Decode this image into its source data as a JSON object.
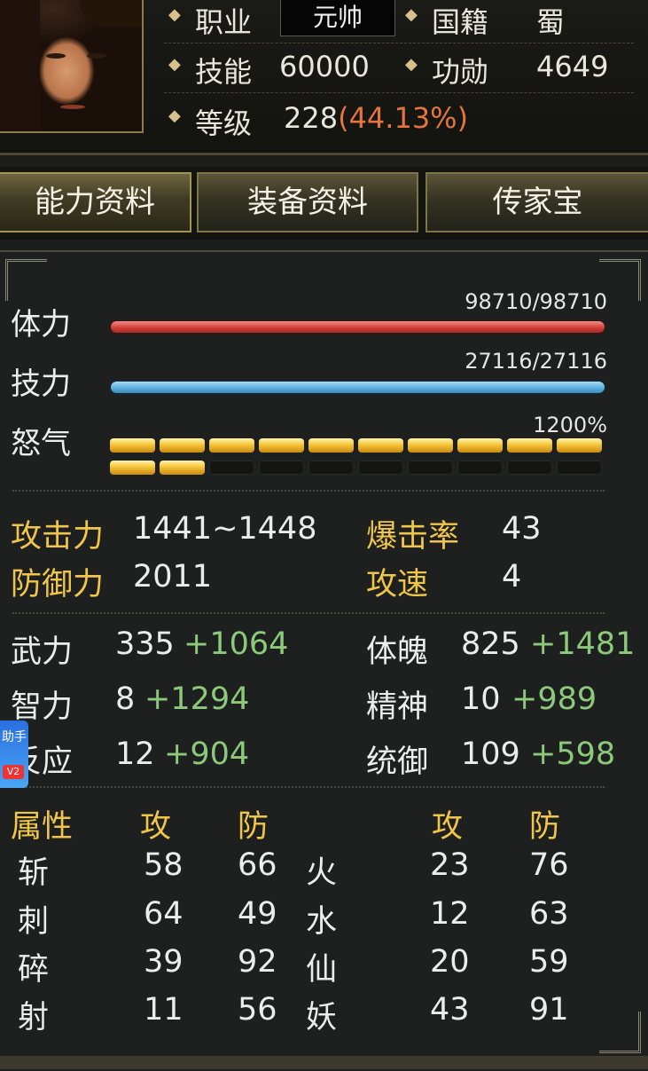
{
  "header": {
    "rows": [
      {
        "l1": "职业",
        "v1": "元帅",
        "l2": "国籍",
        "v2": "蜀"
      },
      {
        "l1": "技能",
        "v1": "60000",
        "l2": "功勋",
        "v2": "4649"
      },
      {
        "l1": "等级",
        "v1": "228",
        "v1b": "(44.13%)"
      }
    ]
  },
  "tabs": [
    {
      "label": "能力资料",
      "active": true
    },
    {
      "label": "装备资料",
      "active": false
    },
    {
      "label": "传家宝",
      "active": false
    }
  ],
  "vitals": {
    "hp": {
      "label": "体力",
      "value": "98710/98710",
      "fraction": 1.0
    },
    "mp": {
      "label": "技力",
      "value": "27116/27116",
      "fraction": 1.0
    },
    "rage": {
      "label": "怒气",
      "value": "1200%",
      "filled": 12,
      "total": 20
    }
  },
  "combat": {
    "attack": {
      "label": "攻击力",
      "value": "1441~1448"
    },
    "crit": {
      "label": "爆击率",
      "value": "43"
    },
    "defense": {
      "label": "防御力",
      "value": "2011"
    },
    "speed": {
      "label": "攻速",
      "value": "4"
    }
  },
  "attributes": [
    {
      "label": "武力",
      "base": "335",
      "bonus": "+1064",
      "label2": "体魄",
      "base2": "825",
      "bonus2": "+1481"
    },
    {
      "label": "智力",
      "base": "8",
      "bonus": "+1294",
      "label2": "精神",
      "base2": "10",
      "bonus2": "+989"
    },
    {
      "label": "反应",
      "base": "12",
      "bonus": "+904",
      "label2": "统御",
      "base2": "109",
      "bonus2": "+598"
    }
  ],
  "elements": {
    "header": {
      "title": "属性",
      "atk": "攻",
      "def": "防",
      "atk2": "攻",
      "def2": "防"
    },
    "rows": [
      {
        "n1": "斩",
        "a1": "58",
        "d1": "66",
        "n2": "火",
        "a2": "23",
        "d2": "76"
      },
      {
        "n1": "刺",
        "a1": "64",
        "d1": "49",
        "n2": "水",
        "a2": "12",
        "d2": "63"
      },
      {
        "n1": "碎",
        "a1": "39",
        "d1": "92",
        "n2": "仙",
        "a2": "20",
        "d2": "59"
      },
      {
        "n1": "射",
        "a1": "11",
        "d1": "56",
        "n2": "妖",
        "a2": "43",
        "d2": "91"
      }
    ]
  },
  "overlay": {
    "badge_text": "助手",
    "badge_tag": "V2"
  },
  "colors": {
    "gold": "#f0c64a",
    "bonus_green": "#8cc97a",
    "percent_orange": "#e5743e",
    "hp_red": "#cf3c37",
    "mp_blue": "#58acdc"
  }
}
